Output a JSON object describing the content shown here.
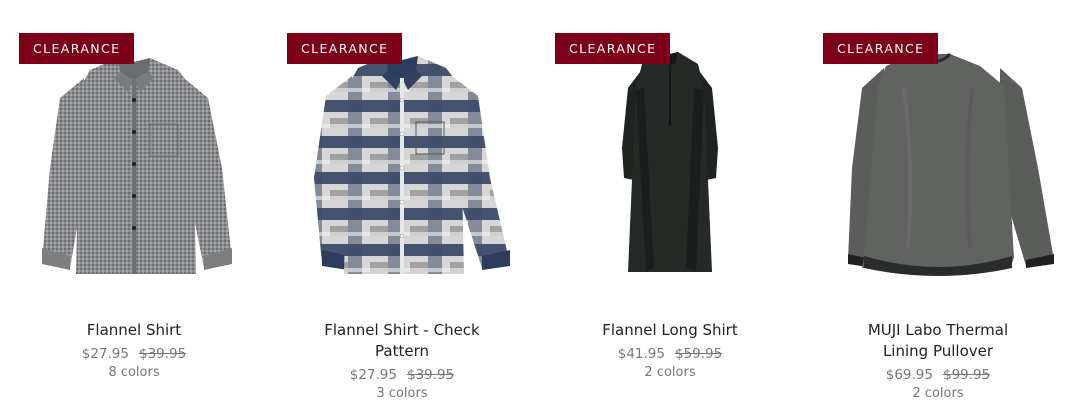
{
  "products": [
    {
      "badge": "CLEARANCE",
      "name": "Flannel Shirt",
      "price": "$27.95",
      "original_price": "$39.95",
      "colors": "8 colors",
      "image": "gray-flannel-shirt"
    },
    {
      "badge": "CLEARANCE",
      "name": "Flannel Shirt - Check Pattern",
      "price": "$27.95",
      "original_price": "$39.95",
      "colors": "3 colors",
      "image": "navy-check-flannel-shirt"
    },
    {
      "badge": "CLEARANCE",
      "name": "Flannel Long Shirt",
      "price": "$41.95",
      "original_price": "$59.95",
      "colors": "2 colors",
      "image": "black-long-shirt-dress"
    },
    {
      "badge": "CLEARANCE",
      "name": "MUJI Labo Thermal Lining Pullover",
      "price": "$69.95",
      "original_price": "$99.95",
      "colors": "2 colors",
      "image": "charcoal-pullover"
    }
  ],
  "colors": {
    "badge_bg": "#7d0019",
    "badge_text": "#ffffff",
    "price_text": "#777777",
    "name_text": "#222222"
  }
}
